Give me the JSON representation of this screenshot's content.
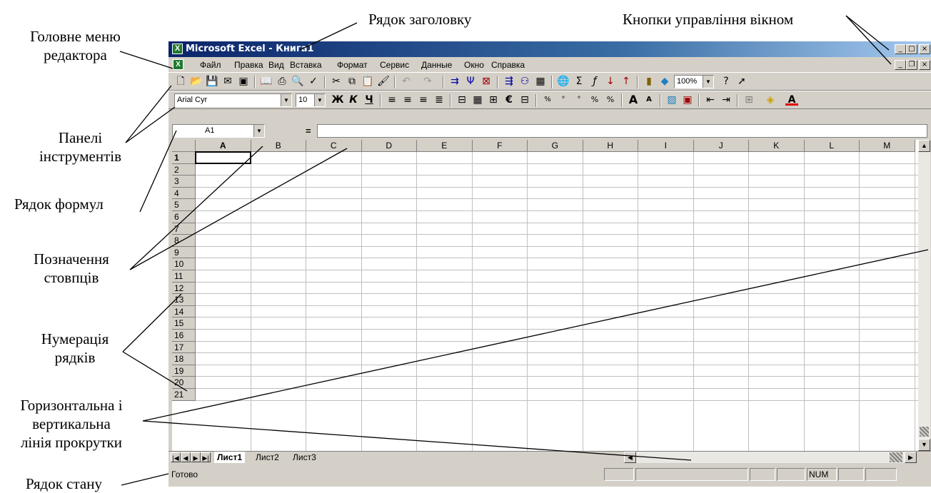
{
  "annotations": {
    "title_row": "Рядок заголовку",
    "window_buttons": "Кнопки управління вікном",
    "main_menu": [
      "Головне меню",
      "редактора"
    ],
    "toolbars": [
      "Панелі",
      "інструментів"
    ],
    "formula_bar": "Рядок формул",
    "column_labels": [
      "Позначення",
      "стовпців"
    ],
    "row_numbers": [
      "Нумерація",
      "рядків"
    ],
    "scrollbars": [
      "Горизонтальна і",
      "вертикальна",
      "лінія прокрутки"
    ],
    "status_bar": "Рядок стану"
  },
  "window": {
    "title": "Microsoft Excel - Книга1",
    "app_icon": "excel-icon",
    "title_buttons": [
      "minimize-icon",
      "maximize-icon",
      "close-icon"
    ],
    "doc_buttons": [
      "minimize-icon",
      "restore-icon",
      "close-icon"
    ]
  },
  "menu": [
    "Файл",
    "Правка",
    "Вид",
    "Вставка",
    "Формат",
    "Сервис",
    "Данные",
    "Окно",
    "Справка"
  ],
  "toolbar_standard": {
    "zoom": "100%",
    "icons": [
      "new-icon",
      "open-icon",
      "save-icon",
      "permission-icon",
      "save-as-icon",
      "book-icon",
      "print-icon",
      "print-preview-icon",
      "spelling-icon",
      "cut-icon",
      "copy-icon",
      "paste-icon",
      "format-painter-icon",
      "undo-icon",
      "redo-icon",
      "trace-precedents-icon",
      "trace-dependents-icon",
      "remove-arrows-icon",
      "trace-error-icon",
      "circle-invalid-icon",
      "calculator-icon",
      "web-icon",
      "autosum-icon",
      "function-icon",
      "sort-ascending-icon",
      "sort-descending-icon",
      "chart-wizard-icon",
      "drawing-icon",
      "help-icon",
      "whats-this-icon"
    ]
  },
  "toolbar_format": {
    "font": "Arial Cyr",
    "size": "10",
    "bold": "Ж",
    "italic": "К",
    "underline": "Ч",
    "icons": [
      "align-left-icon",
      "center-icon",
      "align-right-icon",
      "justify-icon",
      "merge-icon",
      "table-icon",
      "merge-center-icon",
      "euro-icon",
      "borders-table-icon",
      "percent-icon",
      "thousands-icon",
      "decimal-icon",
      "increase-decimal-icon",
      "decrease-decimal-icon",
      "font-grow-icon",
      "font-shrink-icon",
      "image-icon",
      "clip-icon",
      "decrease-indent-icon",
      "increase-indent-icon",
      "borders-icon",
      "fill-color-icon",
      "font-color-icon"
    ]
  },
  "formula_bar": {
    "cell_ref": "A1",
    "equals": "="
  },
  "grid": {
    "columns": [
      "A",
      "B",
      "C",
      "D",
      "E",
      "F",
      "G",
      "H",
      "I",
      "J",
      "K",
      "L",
      "M"
    ],
    "rows": [
      "1",
      "2",
      "3",
      "4",
      "5",
      "6",
      "7",
      "8",
      "9",
      "10",
      "11",
      "12",
      "13",
      "14",
      "15",
      "16",
      "17",
      "18",
      "19",
      "20",
      "21"
    ],
    "active_cell": "A1"
  },
  "sheets": [
    "Лист1",
    "Лист2",
    "Лист3"
  ],
  "status": {
    "ready": "Готово",
    "num": "NUM"
  },
  "colors": {
    "title_bar": "#0a246a",
    "chrome": "#d4d0c8",
    "grid_line": "#c0c0c0"
  }
}
